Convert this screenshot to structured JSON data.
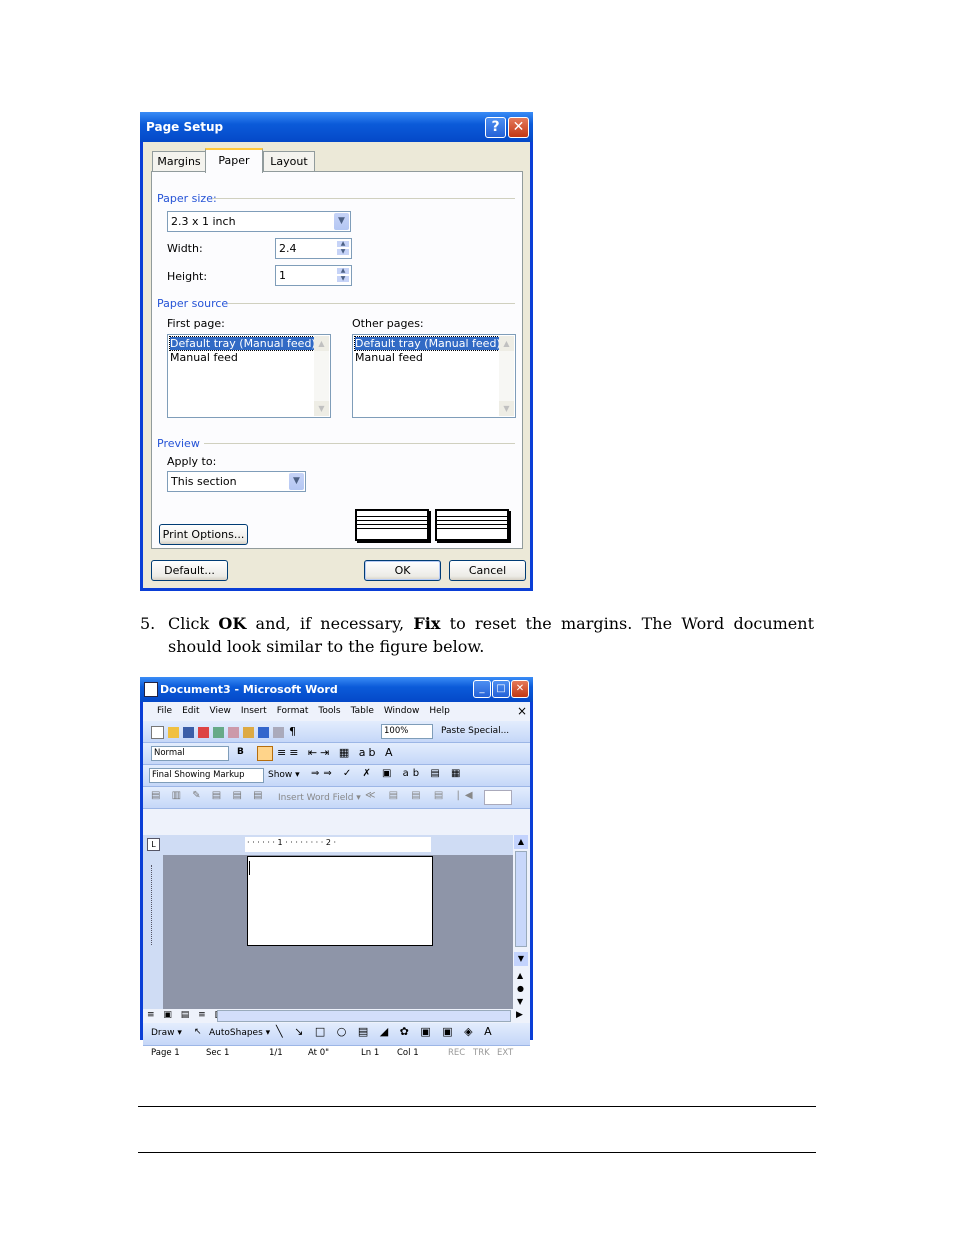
{
  "page_setup": {
    "title": "Page Setup",
    "help_button": "?",
    "close_button": "✕",
    "tabs": [
      "Margins",
      "Paper",
      "Layout"
    ],
    "active_tab": "Paper",
    "paper_size": {
      "group_label": "Paper size:",
      "selected": "2.3 x 1 inch",
      "width_label": "Width:",
      "width_value": "2.4",
      "height_label": "Height:",
      "height_value": "1"
    },
    "paper_source": {
      "group_label": "Paper source",
      "first_page_label": "First page:",
      "first_page_items": [
        "Default tray (Manual feed)",
        "Manual feed"
      ],
      "other_pages_label": "Other pages:",
      "other_pages_items": [
        "Default tray (Manual feed)",
        "Manual feed"
      ]
    },
    "preview": {
      "group_label": "Preview",
      "apply_to_label": "Apply to:",
      "apply_to_value": "This section"
    },
    "print_options_button": "Print Options...",
    "default_button": "Default...",
    "ok_button": "OK",
    "cancel_button": "Cancel"
  },
  "instruction": {
    "number": "5.",
    "segments": [
      "Click ",
      "OK",
      " and, if necessary, ",
      "Fix",
      " to reset the margins. The Word document should look similar to the figure below."
    ]
  },
  "word": {
    "title": "Document3 - Microsoft Word",
    "menu": [
      "File",
      "Edit",
      "View",
      "Insert",
      "Format",
      "Tools",
      "Table",
      "Window",
      "Help"
    ],
    "menu_close": "×",
    "zoom": "100%",
    "paste_special": "Paste Special...",
    "style": "Normal",
    "markup_view": "Final Showing Markup",
    "show_menu": "Show ▾",
    "insert_word_field": "Insert Word Field ▾",
    "ruler_marks": "· · · · · · 1 · · · · · · · · 2 ·",
    "draw_menu": "Draw ▾",
    "autoshapes": "AutoShapes ▾",
    "status": {
      "page": "Page 1",
      "sec": "Sec 1",
      "pages": "1/1",
      "at": "At 0\"",
      "ln": "Ln 1",
      "col": "Col 1",
      "rec": "REC",
      "trk": "TRK",
      "ext": "EXT"
    }
  }
}
